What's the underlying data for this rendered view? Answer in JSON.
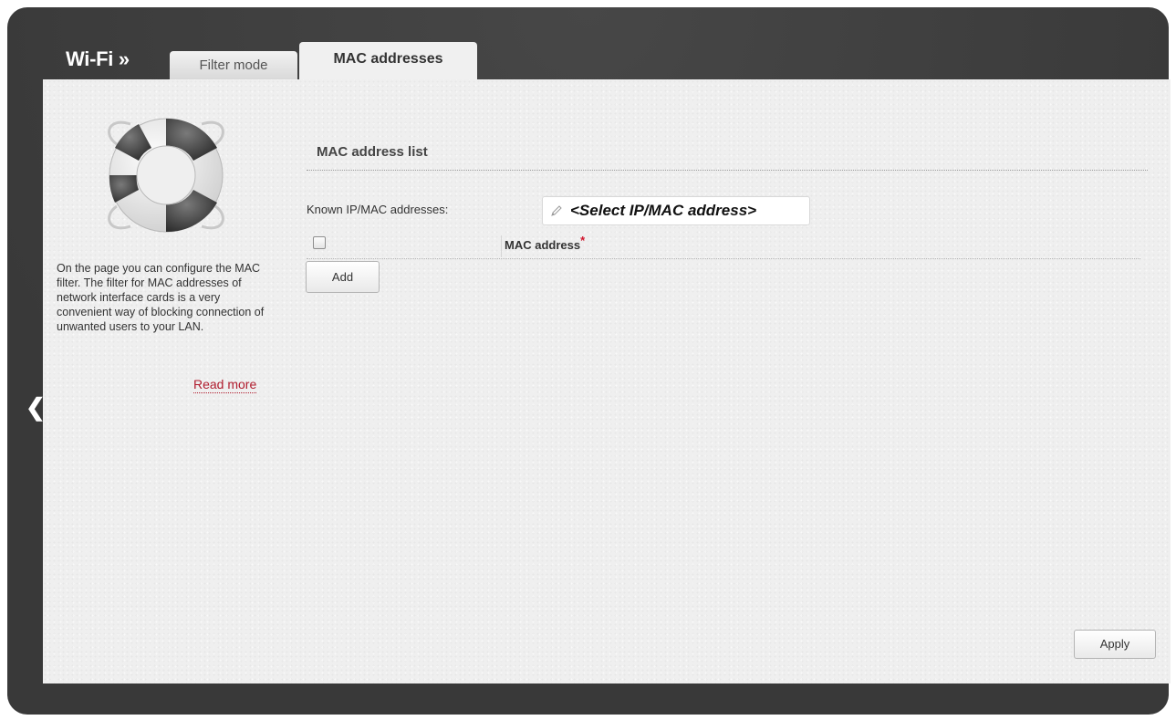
{
  "header": {
    "title": "Wi-Fi »",
    "tabs": [
      {
        "label": "Filter mode",
        "active": false
      },
      {
        "label": "MAC addresses",
        "active": true
      }
    ]
  },
  "sidebar": {
    "help_text": "On the page you can configure the MAC filter. The filter for MAC addresses of network interface cards is a very convenient way of blocking connection of unwanted users to your LAN.",
    "read_more": "Read more",
    "icon": "lifebuoy-icon",
    "back_icon": "chevron-left-icon"
  },
  "main": {
    "section_title": "MAC address list",
    "known_label": "Known IP/MAC addresses:",
    "select_value": "<Select IP/MAC address>",
    "table": {
      "columns": [
        {
          "label": "MAC address",
          "required": true
        }
      ],
      "rows": []
    },
    "add_button": "Add",
    "apply_button": "Apply"
  },
  "colors": {
    "frame_bg": "#3c3c3c",
    "content_bg": "#efefef",
    "link": "#b01c2e",
    "required": "#d0142c"
  }
}
